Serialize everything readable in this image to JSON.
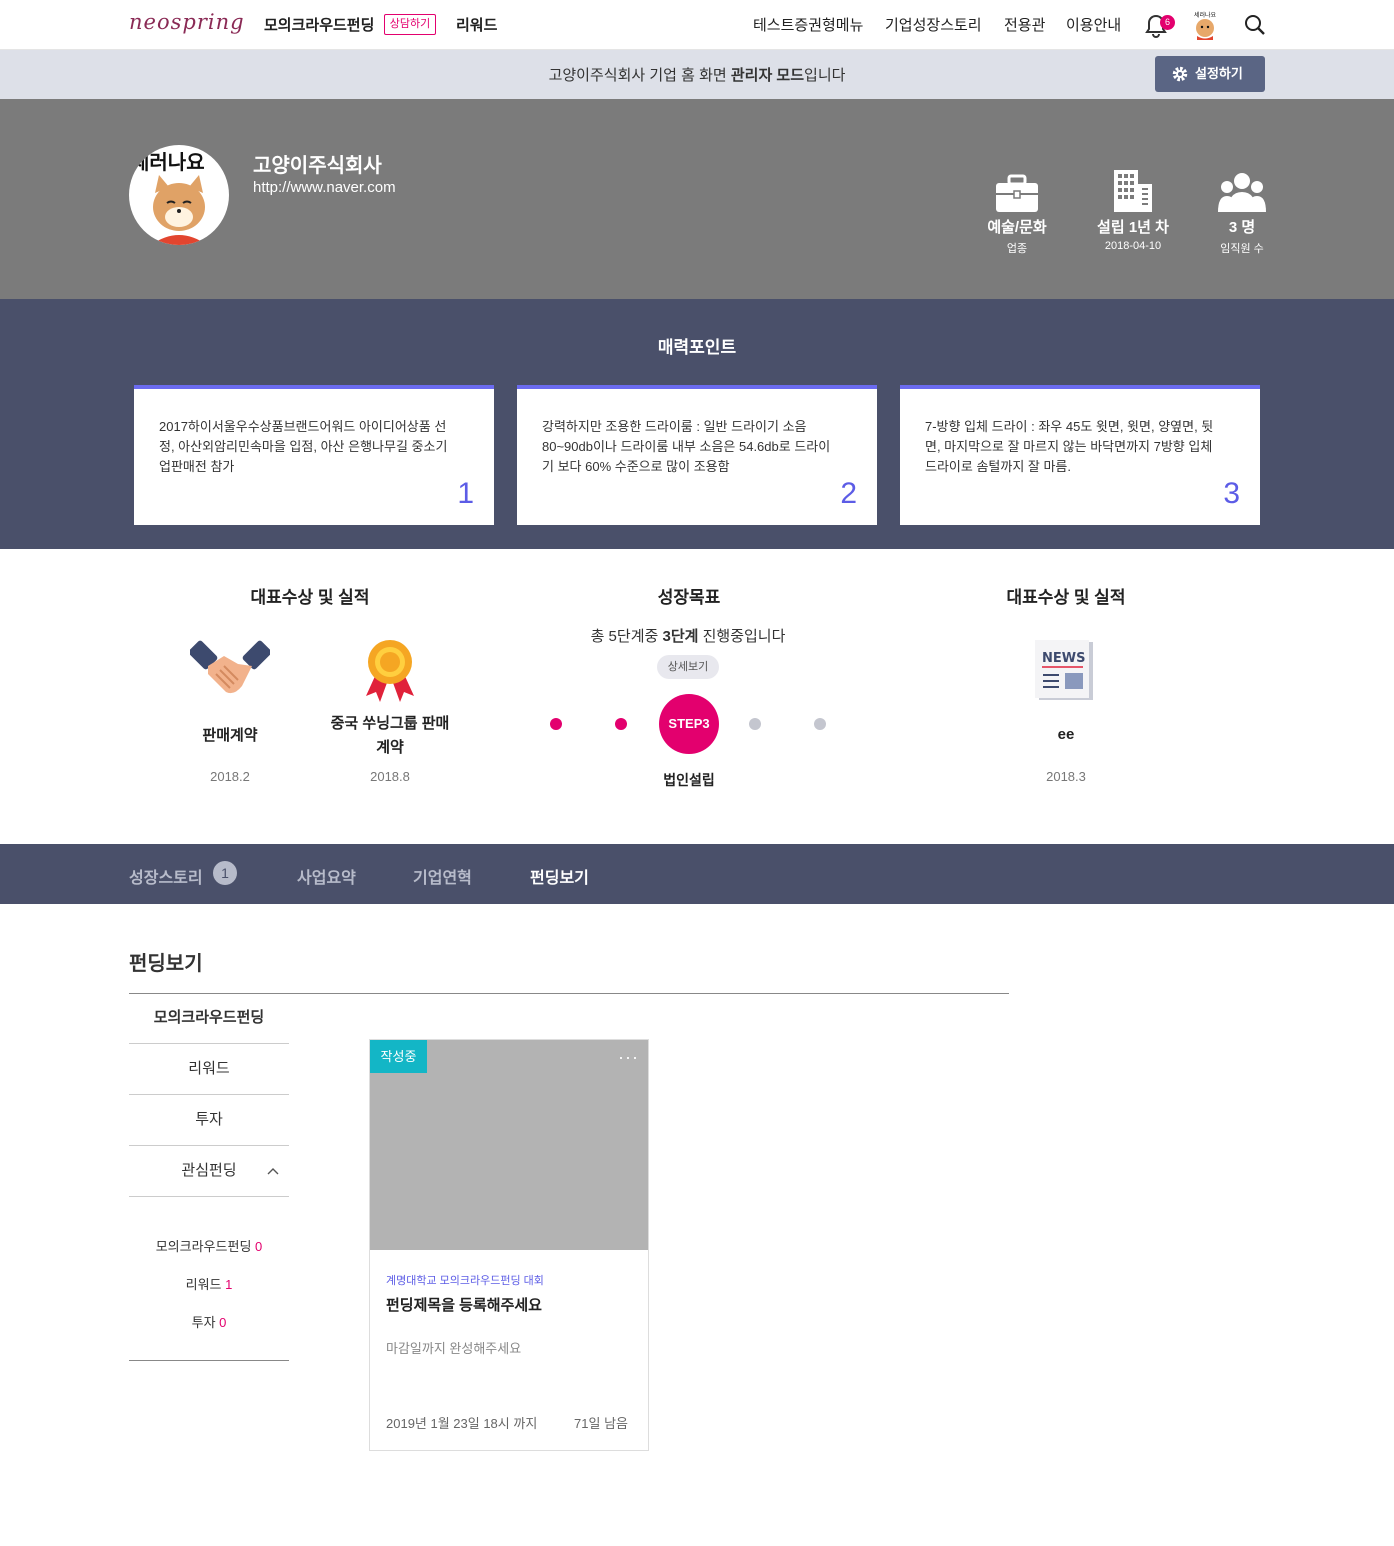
{
  "nav": {
    "logo": "neospring",
    "funding": "모의크라우드펀딩",
    "consult_badge": "상담하기",
    "reward": "리워드",
    "menu": [
      "테스트증권형메뉴",
      "기업성장스토리",
      "전용관",
      "이용안내"
    ],
    "notification_count": "6"
  },
  "admin": {
    "text_pre": "고양이주식회사 기업 홈 화면 ",
    "text_bold": "관리자 모드",
    "text_post": "입니다",
    "settings_label": "설정하기"
  },
  "company": {
    "name": "고양이주식회사",
    "url": "http://www.naver.com",
    "logo_text": "세러나요",
    "stats": [
      {
        "value": "예술/문화",
        "label": "업종",
        "icon": "briefcase-icon"
      },
      {
        "value": "설립 1년 차",
        "label": "2018-04-10",
        "icon": "building-icon"
      },
      {
        "value": "3 명",
        "label": "임직원 수",
        "icon": "people-icon"
      }
    ]
  },
  "charm": {
    "title": "매력포인트",
    "points": [
      {
        "text": "2017하이서울우수상품브랜드어워드 아이디어상품 선정, 아산외암리민속마을 입점, 아산 은행나무길 중소기업판매전 참가",
        "num": "1"
      },
      {
        "text": "강력하지만 조용한 드라이룸 : 일반 드라이기 소음 80~90db이나 드라이룸 내부 소음은 54.6db로 드라이기 보다 60% 수준으로 많이 조용함",
        "num": "2"
      },
      {
        "text": "7-방향 입체 드라이 : 좌우 45도 윗면, 윗면, 양옆면, 뒷면, 마지막으로 잘 마르지 않는 바닥면까지 7방향 입체 드라이로 솜털까지 잘 마름.",
        "num": "3"
      }
    ]
  },
  "achievements": {
    "title": "대표수상 및 실적",
    "items": [
      {
        "label": "판매계약",
        "date": "2018.2",
        "icon": "handshake-icon"
      },
      {
        "label": "중국 쑤닝그룹 판매계약",
        "date": "2018.8",
        "icon": "medal-icon"
      }
    ]
  },
  "goal": {
    "title": "성장목표",
    "text_pre": "총 5단계중 ",
    "text_bold": "3단계",
    "text_post": " 진행중입니다",
    "detail": "상세보기",
    "current_step": "STEP3",
    "step_name": "법인설립",
    "total_steps": 5,
    "current_index": 3,
    "colors": {
      "done": "#e3006e",
      "pending": "#c4c6cf"
    }
  },
  "achievements2": {
    "title": "대표수상 및 실적",
    "items": [
      {
        "label": "ee",
        "date": "2018.3",
        "icon": "news-icon"
      }
    ]
  },
  "tabs": [
    {
      "label": "성장스토리",
      "count": "1"
    },
    {
      "label": "사업요약"
    },
    {
      "label": "기업연혁"
    },
    {
      "label": "펀딩보기",
      "active": true
    }
  ],
  "funding": {
    "title": "펀딩보기",
    "sidebar": [
      "모의크라우드펀딩",
      "리워드",
      "투자",
      "관심펀딩"
    ],
    "sub": [
      {
        "label": "모의크라우드펀딩",
        "count": "0"
      },
      {
        "label": "리워드",
        "count": "1"
      },
      {
        "label": "투자",
        "count": "0"
      }
    ],
    "card": {
      "status": "작성중",
      "more": "···",
      "event": "계명대학교 모의크라우드펀딩 대회",
      "title": "펀딩제목을 등록해주세요",
      "desc": "마감일까지 완성해주세요",
      "deadline": "2019년 1월 23일 18시 까지",
      "remaining": "71일 남음"
    }
  },
  "colors": {
    "accent": "#e3006e",
    "navy": "#4a506a",
    "purple": "#5c5ce6",
    "teal": "#13b6c6"
  }
}
